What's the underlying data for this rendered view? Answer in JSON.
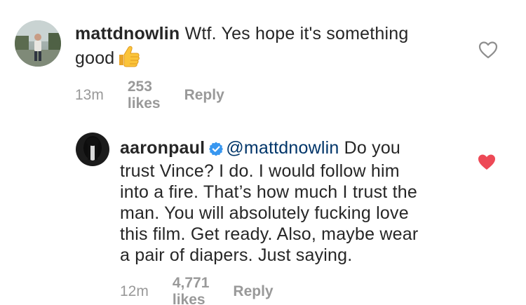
{
  "comments": [
    {
      "username": "mattdnowlin",
      "text_line1": "Wtf. Yes hope it's something",
      "text_line2": "good",
      "emoji": "thumbs-up",
      "time": "13m",
      "likes": "253 likes",
      "reply_label": "Reply",
      "liked": false,
      "avatar_icon": "avatar"
    },
    {
      "username": "aaronpaul",
      "verified": true,
      "mention": "@mattdnowlin",
      "text_line1_rest": "Do you",
      "text_lines": [
        "trust Vince? I do. I would follow him",
        "into a fire. That’s how much I trust the",
        "man. You will absolutely fucking love",
        "this film. Get ready. Also, maybe wear",
        "a pair of diapers. Just saying."
      ],
      "time": "12m",
      "likes": "4,771 likes",
      "reply_label": "Reply",
      "liked": true,
      "avatar_icon": "avatar"
    }
  ],
  "colors": {
    "text": "#262626",
    "meta": "#999999",
    "mention": "#003569",
    "heart_liked": "#ed4956",
    "heart_outline": "#8e8e8e",
    "verified": "#3897f0"
  }
}
